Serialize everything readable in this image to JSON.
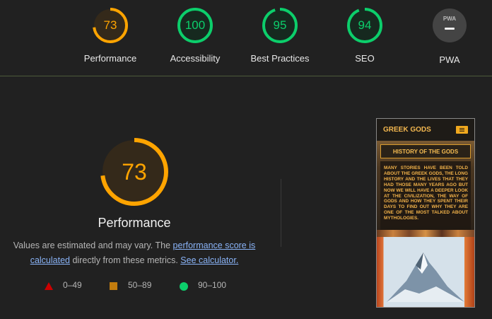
{
  "categories": [
    {
      "name": "Performance",
      "score": "73",
      "value": 73,
      "color": "#ffa400"
    },
    {
      "name": "Accessibility",
      "score": "100",
      "value": 100,
      "color": "#0cce6b"
    },
    {
      "name": "Best Practices",
      "score": "95",
      "value": 95,
      "color": "#0cce6b"
    },
    {
      "name": "SEO",
      "score": "94",
      "value": 94,
      "color": "#0cce6b"
    },
    {
      "name": "PWA",
      "badge": "PWA"
    }
  ],
  "main": {
    "score": "73",
    "value": 73,
    "color": "#ffa400",
    "title": "Performance",
    "desc_prefix": "Values are estimated and may vary. The ",
    "link_score": "performance score is calculated",
    "desc_mid": " directly from these metrics. ",
    "link_calculator": "See calculator."
  },
  "legend": [
    {
      "range": "0–49",
      "icon": "triangle-fail-icon",
      "color": "#cc0000"
    },
    {
      "range": "50–89",
      "icon": "square-average-icon",
      "color": "#c27c0e"
    },
    {
      "range": "90–100",
      "icon": "circle-pass-icon",
      "color": "#0cce6b"
    }
  ],
  "screenshot": {
    "site_title": "GREEK GODS",
    "menu_icon": "hamburger-menu-icon",
    "banner": "HISTORY OF THE GODS",
    "paragraph": "Many stories have been told about the Greek Gods, the long history and the lives that they had those many years ago but now we will have a deeper look at the civilization, the way of gods and how they spent their days to find out why they are one of the most talked about mythologies."
  }
}
